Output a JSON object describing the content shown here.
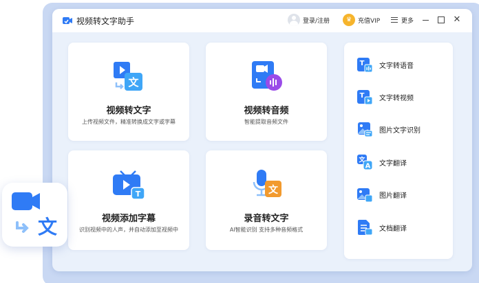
{
  "app": {
    "title": "视频转文字助手"
  },
  "titlebar": {
    "login": "登录/注册",
    "vip": "充值VIP",
    "more": "更多"
  },
  "cards": [
    {
      "title": "视频转文字",
      "desc": "上传视频文件，精准转换成文字或字幕"
    },
    {
      "title": "视频转音频",
      "desc": "智能提取音频文件"
    },
    {
      "title": "视频添加字幕",
      "desc": "识别视频中的人声，并自动添加至视频中"
    },
    {
      "title": "录音转文字",
      "desc": "AI智能识别 支持多种音频格式"
    }
  ],
  "sidebar": {
    "items": [
      {
        "label": "文字转语音"
      },
      {
        "label": "文字转视频"
      },
      {
        "label": "图片文字识别"
      },
      {
        "label": "文字翻译"
      },
      {
        "label": "图片翻译"
      },
      {
        "label": "文档翻译"
      }
    ]
  },
  "icons": {
    "wen": "文",
    "T": "T",
    "A": "A"
  },
  "colors": {
    "accent": "#2f7bf5",
    "orange": "#f29a2e",
    "purple": "#9a4be8",
    "vip": "#f6b42c"
  }
}
